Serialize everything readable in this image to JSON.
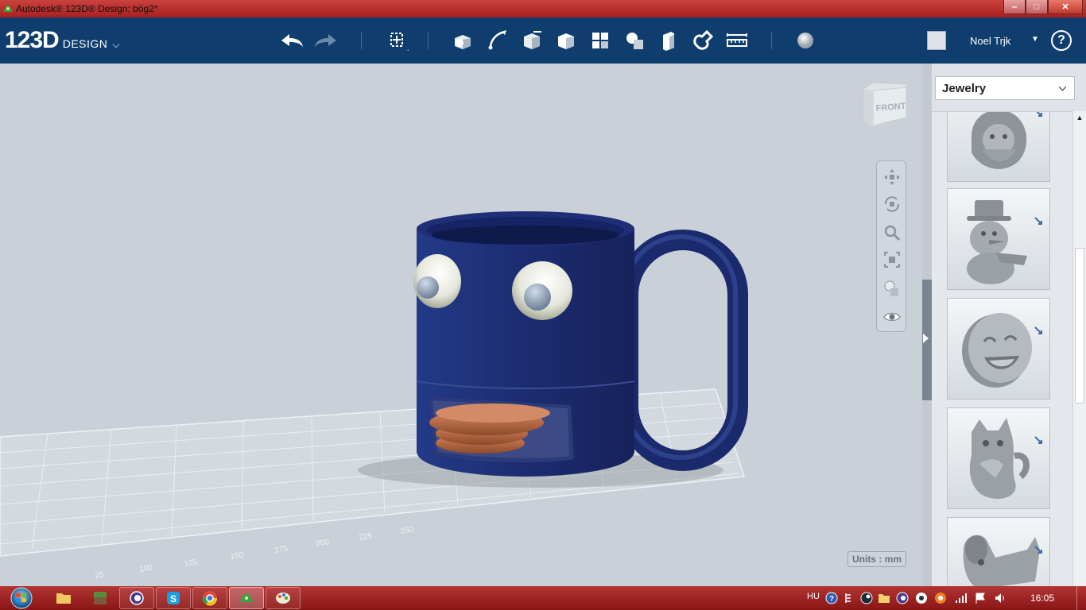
{
  "window": {
    "title": "Autodesk® 123D® Design: bög2*",
    "minimize": "‒",
    "maximize": "□",
    "close": "✕"
  },
  "logo": {
    "main": "123D",
    "sub": "DESIGN"
  },
  "toolbar": {
    "tools": [
      "undo-icon",
      "redo-icon",
      "transform-icon",
      "primitives-icon",
      "sketch-icon",
      "construct-icon",
      "modify-icon",
      "pattern-icon",
      "grouping-icon",
      "combine-icon",
      "measure-icon",
      "snap-icon",
      "ruler-icon",
      "material-icon"
    ]
  },
  "user": {
    "name": "Noel Trjk",
    "help": "?"
  },
  "viewcube": {
    "face": "FRONT"
  },
  "units": "Units : mm",
  "panel": {
    "category": "Jewelry"
  },
  "taskbar": {
    "language": "HU",
    "clock": "16:05"
  },
  "colors": {
    "toolbar": "#0f3e6e",
    "mug": "#1a2a6c",
    "coins": "#c06a45",
    "titlebar": "#b02a28"
  }
}
